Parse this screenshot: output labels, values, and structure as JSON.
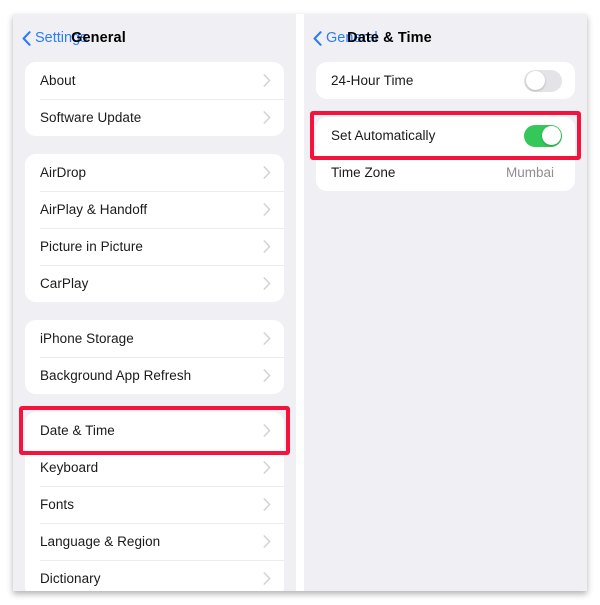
{
  "left_panel": {
    "navbar": {
      "back_label": "Settings",
      "title": "General",
      "back_icon": "chevron-left-icon"
    },
    "groups": [
      {
        "rows": [
          {
            "label": "About",
            "accessory": "chevron-right-icon"
          },
          {
            "label": "Software Update",
            "accessory": "chevron-right-icon"
          }
        ]
      },
      {
        "rows": [
          {
            "label": "AirDrop",
            "accessory": "chevron-right-icon"
          },
          {
            "label": "AirPlay & Handoff",
            "accessory": "chevron-right-icon"
          },
          {
            "label": "Picture in Picture",
            "accessory": "chevron-right-icon"
          },
          {
            "label": "CarPlay",
            "accessory": "chevron-right-icon"
          }
        ]
      },
      {
        "rows": [
          {
            "label": "iPhone Storage",
            "accessory": "chevron-right-icon"
          },
          {
            "label": "Background App Refresh",
            "accessory": "chevron-right-icon"
          }
        ]
      },
      {
        "rows": [
          {
            "label": "Date & Time",
            "accessory": "chevron-right-icon",
            "highlighted": true
          },
          {
            "label": "Keyboard",
            "accessory": "chevron-right-icon"
          },
          {
            "label": "Fonts",
            "accessory": "chevron-right-icon"
          },
          {
            "label": "Language & Region",
            "accessory": "chevron-right-icon"
          },
          {
            "label": "Dictionary",
            "accessory": "chevron-right-icon"
          }
        ]
      }
    ]
  },
  "right_panel": {
    "navbar": {
      "back_label": "General",
      "title": "Date & Time",
      "back_icon": "chevron-left-icon"
    },
    "groups": [
      {
        "rows": [
          {
            "label": "24-Hour Time",
            "accessory": "toggle",
            "toggle_state": "off"
          }
        ]
      },
      {
        "rows": [
          {
            "label": "Set Automatically",
            "accessory": "toggle",
            "toggle_state": "on",
            "highlighted": true
          },
          {
            "label": "Time Zone",
            "accessory": "value",
            "value": "Mumbai"
          }
        ]
      }
    ]
  },
  "colors": {
    "accent_blue": "#2b7cf7",
    "toggle_on_green": "#35c759",
    "toggle_off_gray": "#e4e4e8",
    "highlight_red": "#f5133e",
    "panel_background": "#f0f0f4",
    "row_background": "#ffffff",
    "secondary_text": "#8e8e93"
  }
}
